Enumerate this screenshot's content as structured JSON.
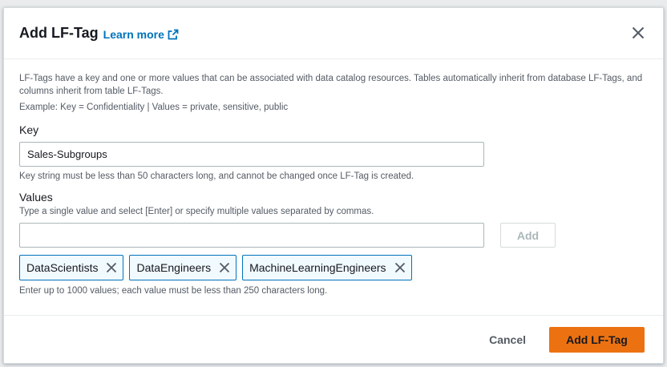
{
  "modal": {
    "title": "Add LF-Tag",
    "learn_more": "Learn more",
    "description": "LF-Tags have a key and one or more values that can be associated with data catalog resources. Tables automatically inherit from database LF-Tags, and columns inherit from table LF-Tags.",
    "example": "Example: Key = Confidentiality | Values = private, sensitive, public"
  },
  "key": {
    "label": "Key",
    "value": "Sales-Subgroups",
    "hint": "Key string must be less than 50 characters long, and cannot be changed once LF-Tag is created."
  },
  "values": {
    "label": "Values",
    "description": "Type a single value and select [Enter] or specify multiple values separated by commas.",
    "input_value": "",
    "add_label": "Add",
    "tokens": [
      "DataScientists",
      "DataEngineers",
      "MachineLearningEngineers"
    ],
    "hint": "Enter up to 1000 values; each value must be less than 250 characters long."
  },
  "footer": {
    "cancel_label": "Cancel",
    "submit_label": "Add LF-Tag"
  },
  "colors": {
    "primary": "#ec7211",
    "link": "#0073bb",
    "token_bg": "#f1faff"
  },
  "icons": {
    "close": "close-icon",
    "external_link": "external-link-icon",
    "token_remove": "dismiss-icon"
  }
}
